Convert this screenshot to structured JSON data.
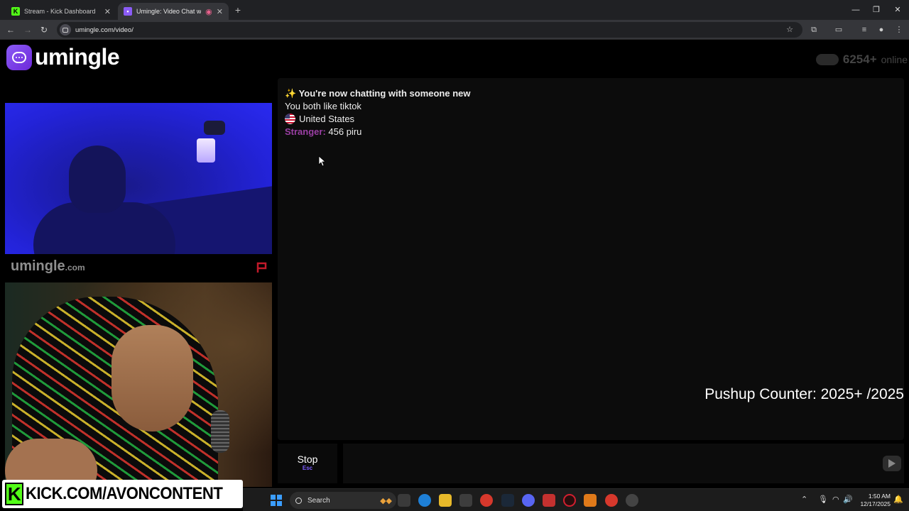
{
  "browser": {
    "tabs": [
      {
        "title": "Stream - Kick Dashboard",
        "favicon": "kick-icon",
        "active": false
      },
      {
        "title": "Umingle: Video Chat with S",
        "favicon": "umingle-icon",
        "active": true
      }
    ],
    "url": "umingle.com/video/"
  },
  "site": {
    "logo_text": "umingle",
    "online_count": "6254+",
    "online_label": "online"
  },
  "video": {
    "watermark_main": "umingle",
    "watermark_tld": ".com"
  },
  "chat": {
    "intro_icon": "✨",
    "intro": "You're now chatting with someone new",
    "common_interest": "You both like tiktok",
    "country": "United States",
    "stranger_label": "Stranger:",
    "stranger_message": "456 piru"
  },
  "overlay": {
    "pushup_counter": "Pushup Counter: 2025+ /2025",
    "kick_url": "KICK.COM/AVONCONTENT",
    "kick_letter": "K"
  },
  "controls": {
    "stop_label": "Stop",
    "stop_key": "Esc",
    "message_placeholder": ""
  },
  "taskbar": {
    "search_label": "Search",
    "time": "1:50 AM",
    "date": "12/17/2025"
  },
  "colors": {
    "accent": "#8b5cf6",
    "stranger": "#9b3fa4",
    "kick_green": "#53fc18"
  }
}
